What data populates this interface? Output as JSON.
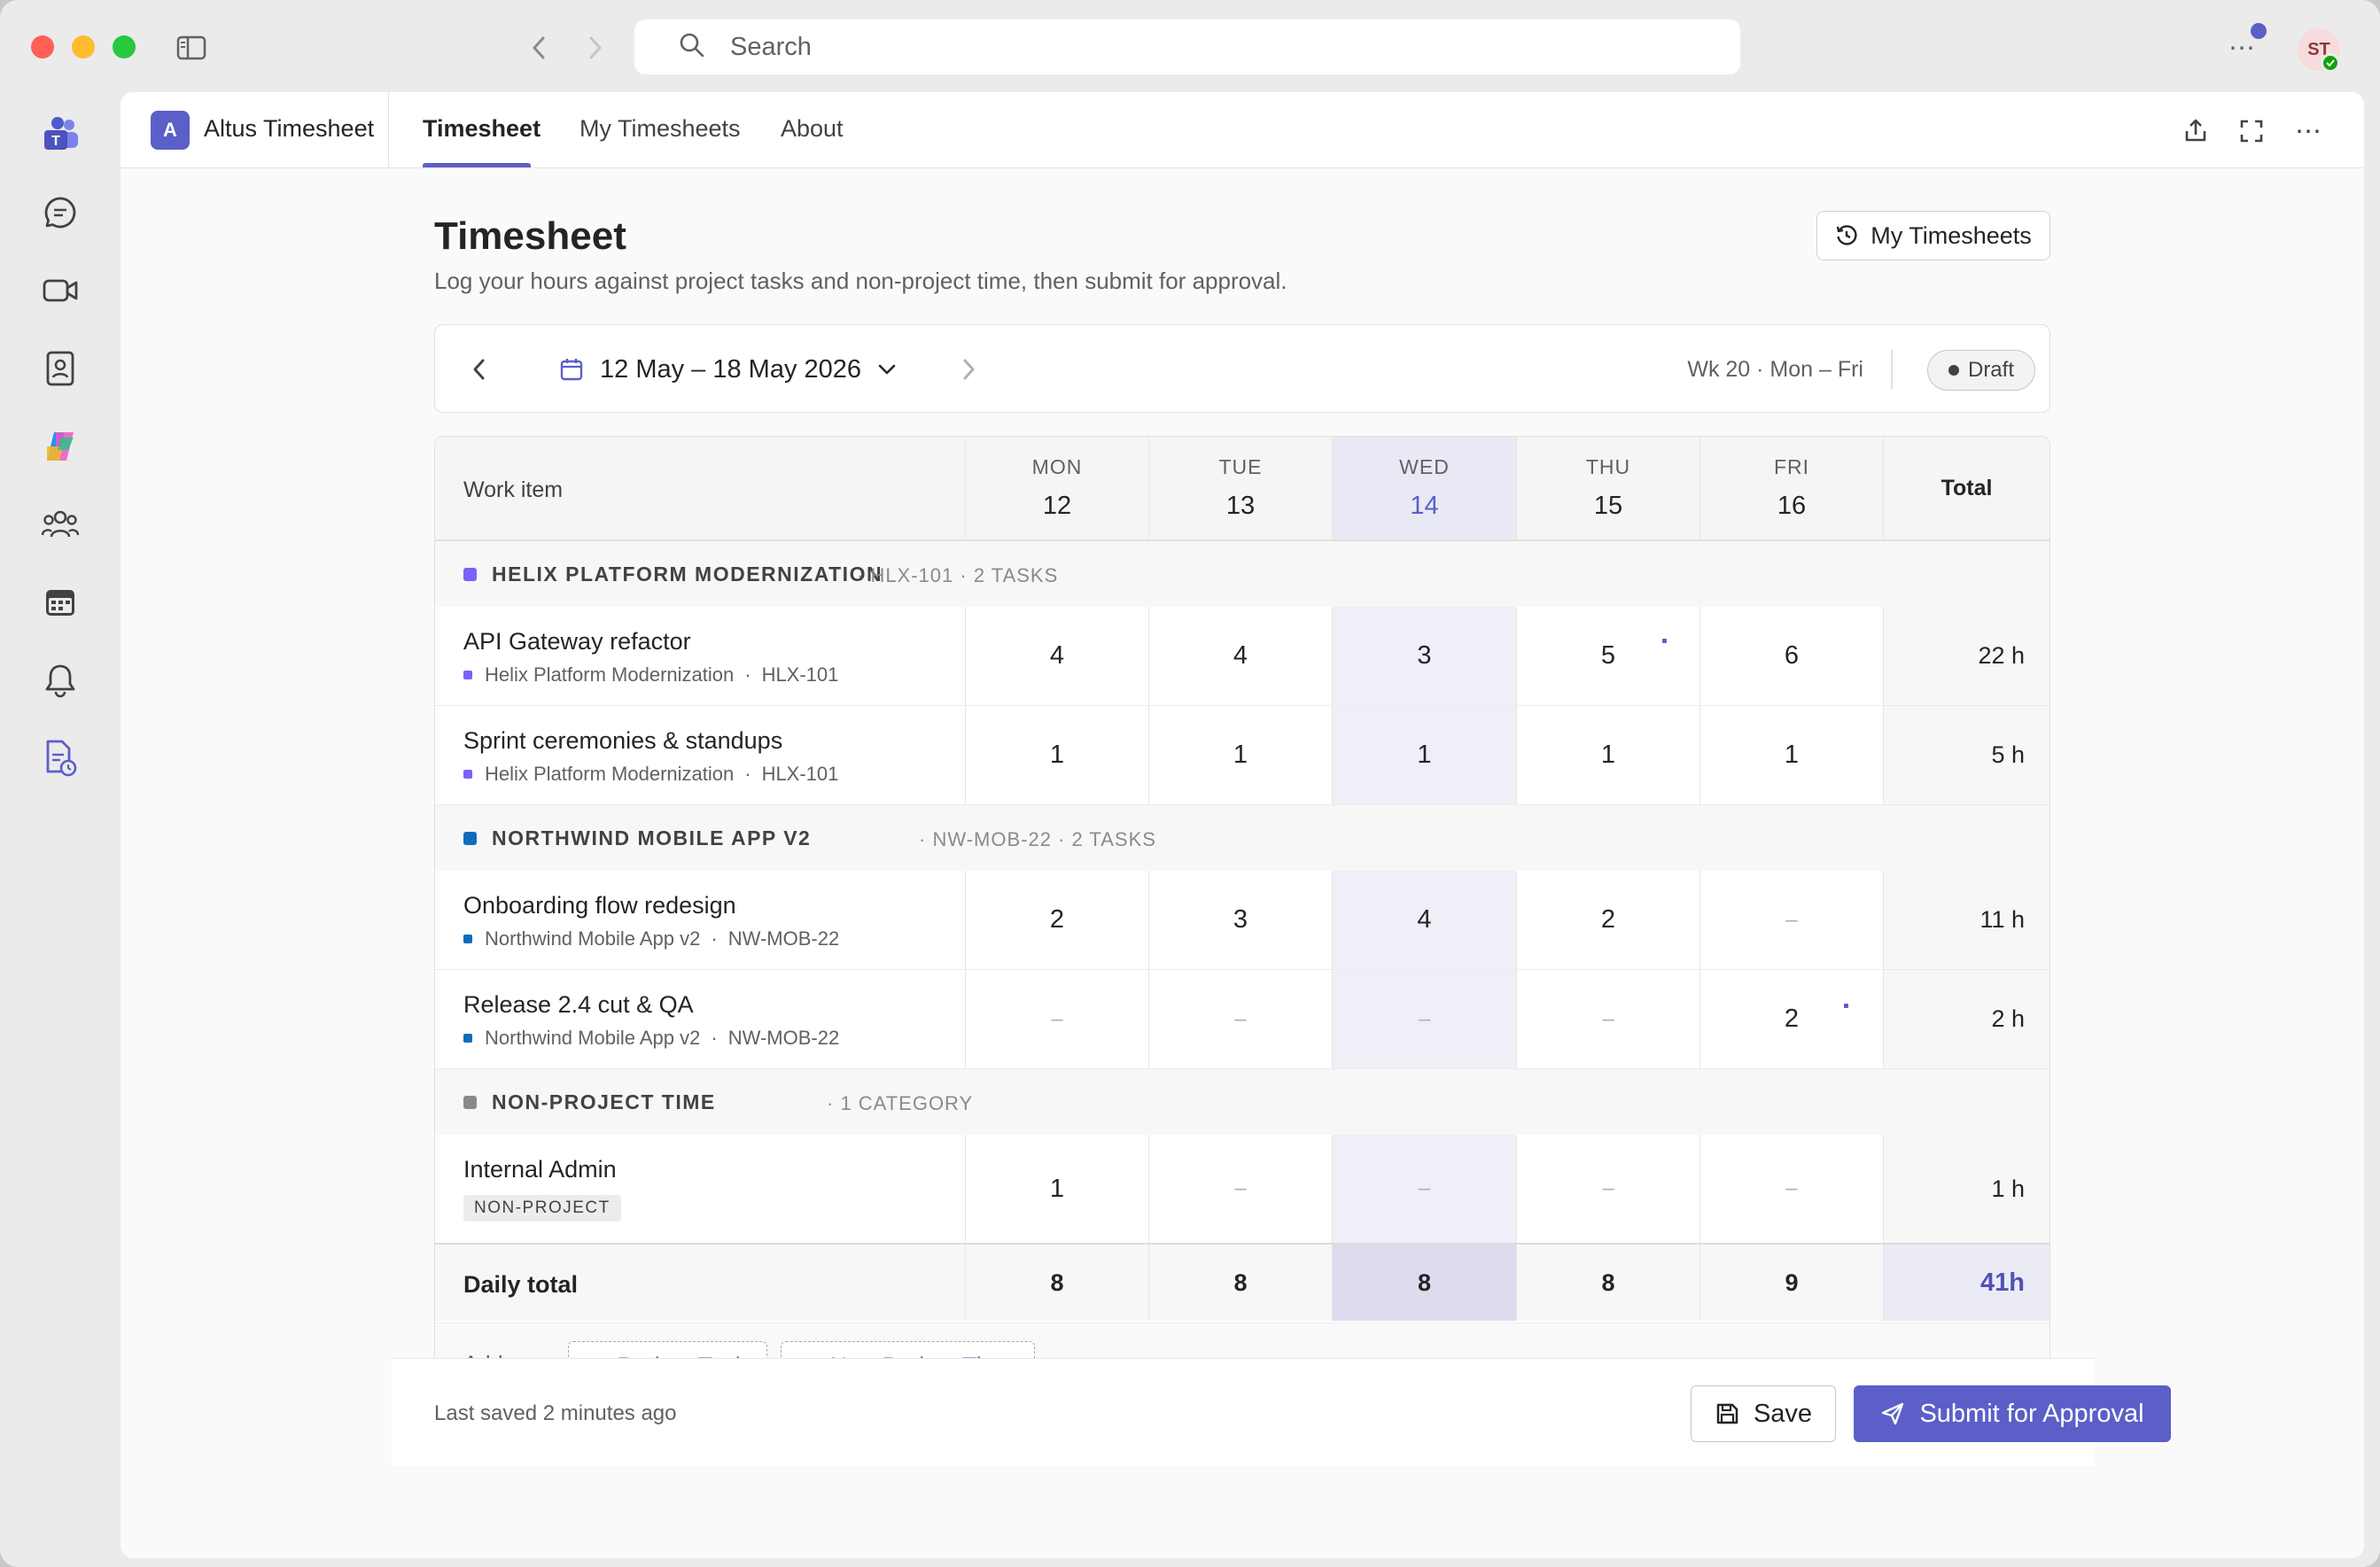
{
  "search": {
    "placeholder": "Search"
  },
  "user": {
    "initials": "ST"
  },
  "app": {
    "logo_letter": "A",
    "name": "Altus Timesheet",
    "tabs": [
      "Timesheet",
      "My Timesheets",
      "About"
    ],
    "active_tab": "Timesheet"
  },
  "page": {
    "title": "Timesheet",
    "subtitle": "Log your hours against project tasks and non-project time, then submit for approval.",
    "my_timesheets_button": "My Timesheets"
  },
  "week": {
    "range": "12 May – 18 May 2026",
    "meta": "Wk 20 · Mon – Fri",
    "status": "Draft"
  },
  "grid": {
    "work_item_header": "Work item",
    "total_header": "Total",
    "days": [
      {
        "name": "MON",
        "num": "12"
      },
      {
        "name": "TUE",
        "num": "13"
      },
      {
        "name": "WED",
        "num": "14"
      },
      {
        "name": "THU",
        "num": "15"
      },
      {
        "name": "FRI",
        "num": "16"
      }
    ],
    "highlight_day": "WED",
    "groups": [
      {
        "name": "HELIX PLATFORM MODERNIZATION",
        "meta": "· HLX-101 · 2 TASKS",
        "color": "#7b61ff",
        "rows": [
          {
            "name": "API Gateway refactor",
            "project": "Helix Platform Modernization",
            "code": "HLX-101",
            "hours": [
              "4",
              "4",
              "3",
              "5",
              "6"
            ],
            "total": "22 h"
          },
          {
            "name": "Sprint ceremonies & standups",
            "project": "Helix Platform Modernization",
            "code": "HLX-101",
            "hours": [
              "1",
              "1",
              "1",
              "1",
              "1"
            ],
            "total": "5 h"
          }
        ]
      },
      {
        "name": "NORTHWIND MOBILE APP V2",
        "meta": "· NW-MOB-22 · 2 TASKS",
        "color": "#0f6cbd",
        "rows": [
          {
            "name": "Onboarding flow redesign",
            "project": "Northwind Mobile App v2",
            "code": "NW-MOB-22",
            "hours": [
              "2",
              "3",
              "4",
              "2",
              "–"
            ],
            "total": "11 h"
          },
          {
            "name": "Release 2.4 cut & QA",
            "project": "Northwind Mobile App v2",
            "code": "NW-MOB-22",
            "hours": [
              "–",
              "–",
              "–",
              "–",
              "2"
            ],
            "total": "2 h"
          }
        ]
      },
      {
        "name": "NON-PROJECT TIME",
        "meta": "· 1 CATEGORY",
        "color": "#8a8a8a",
        "rows": [
          {
            "name": "Internal Admin",
            "tag": "NON-PROJECT",
            "hours": [
              "1",
              "–",
              "–",
              "–",
              "–"
            ],
            "total": "1 h"
          }
        ]
      }
    ],
    "daily_total_label": "Daily total",
    "daily_totals": [
      "8",
      "8",
      "8",
      "8",
      "9"
    ],
    "grand_total": "41h",
    "add_row_label": "Add row:",
    "add_project_task": "Project Task",
    "add_non_project": "Non-Project Time"
  },
  "footer": {
    "last_saved": "Last saved 2 minutes ago",
    "save": "Save",
    "submit": "Submit for Approval"
  },
  "colors": {
    "accent": "#5b5fc7",
    "helix": "#7b61ff",
    "northwind": "#0f6cbd",
    "nonproject": "#8a8a8a"
  }
}
